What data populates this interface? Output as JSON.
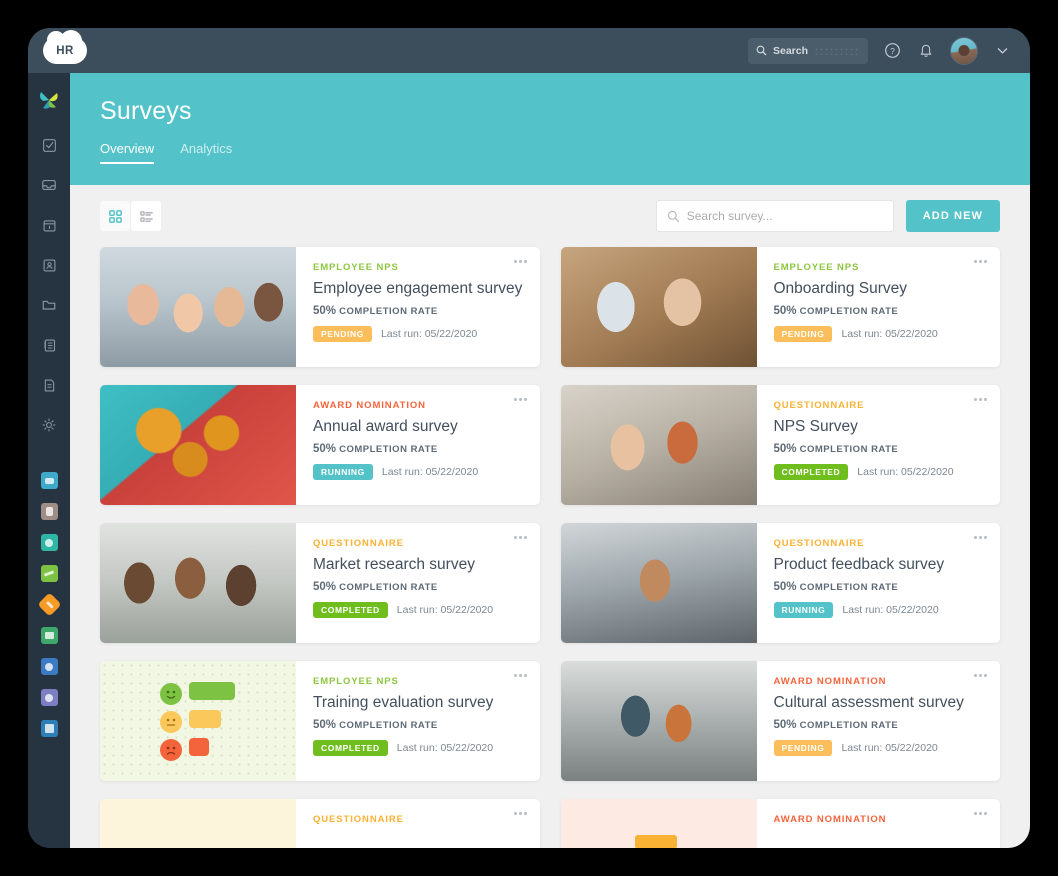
{
  "topbar": {
    "logo_text": "HR",
    "search_label": "Search",
    "help_icon": "help-circle-icon",
    "bell_icon": "bell-icon",
    "avatar_icon": "user-avatar",
    "chevron_icon": "chevron-down-icon"
  },
  "sidebar": {
    "logo_icon": "app-logo-icon",
    "nav_icons": [
      "checkbox-task-icon",
      "inbox-icon",
      "calendar-icon",
      "contact-card-icon",
      "folder-icon",
      "list-document-icon",
      "note-document-icon",
      "gear-settings-icon"
    ],
    "app_icons": [
      {
        "name": "analytics-app-icon",
        "color": "#3FA9C9"
      },
      {
        "name": "briefcase-app-icon",
        "color": "#A08D86"
      },
      {
        "name": "target-app-icon",
        "color": "#2FB7A6"
      },
      {
        "name": "chart-growth-app-icon",
        "color": "#7DC242"
      },
      {
        "name": "plus-diamond-app-icon",
        "color": "#F59B26"
      },
      {
        "name": "monitor-app-icon",
        "color": "#3FA96B"
      },
      {
        "name": "review-app-icon",
        "color": "#3B7BC4"
      },
      {
        "name": "people-app-icon",
        "color": "#7C7FC4"
      },
      {
        "name": "network-app-icon",
        "color": "#2E7FB8"
      }
    ]
  },
  "hero": {
    "title": "Surveys",
    "tabs": [
      {
        "label": "Overview",
        "active": true
      },
      {
        "label": "Analytics",
        "active": false
      }
    ]
  },
  "toolbar": {
    "grid_view_icon": "grid-view-icon",
    "list_view_icon": "list-view-icon",
    "search_icon": "search-icon",
    "search_placeholder": "Search survey...",
    "search_value": "",
    "add_button_label": "ADD NEW"
  },
  "colors": {
    "teal": "#53C3C9",
    "nps_green": "#8DC63F",
    "award_orange": "#F4643C",
    "questionnaire_yellow": "#F9B233",
    "badge_pending": "#FBBE5B",
    "badge_running": "#53C3C9",
    "badge_completed": "#6FBE1E",
    "page_bg": "#F0F0F0",
    "sidebar_bg": "#263340",
    "topbar_bg": "#3C4D5C"
  },
  "cards": [
    {
      "category": "EMPLOYEE NPS",
      "category_type": "nps",
      "title": "Employee engagement survey",
      "rate_value": "50%",
      "rate_label": "COMPLETION RATE",
      "status": "PENDING",
      "status_type": "pending",
      "last_run": "Last run: 05/22/2020",
      "thumb": "photo-group-of-colleagues"
    },
    {
      "category": "EMPLOYEE NPS",
      "category_type": "nps",
      "title": "Onboarding Survey",
      "rate_value": "50%",
      "rate_label": "COMPLETION RATE",
      "status": "PENDING",
      "status_type": "pending",
      "last_run": "Last run: 05/22/2020",
      "thumb": "photo-two-people-at-laptop"
    },
    {
      "category": "AWARD NOMINATION",
      "category_type": "award",
      "title": "Annual award survey",
      "rate_value": "50%",
      "rate_label": "COMPLETION RATE",
      "status": "RUNNING",
      "status_type": "running",
      "last_run": "Last run: 05/22/2020",
      "thumb": "photo-medals"
    },
    {
      "category": "QUESTIONNAIRE",
      "category_type": "quest",
      "title": "NPS Survey",
      "rate_value": "50%",
      "rate_label": "COMPLETION RATE",
      "status": "COMPLETED",
      "status_type": "completed",
      "last_run": "Last run: 05/22/2020",
      "thumb": "photo-two-women-with-tablet"
    },
    {
      "category": "QUESTIONNAIRE",
      "category_type": "quest",
      "title": "Market research survey",
      "rate_value": "50%",
      "rate_label": "COMPLETION RATE",
      "status": "COMPLETED",
      "status_type": "completed",
      "last_run": "Last run: 05/22/2020",
      "thumb": "photo-group-with-tablet"
    },
    {
      "category": "QUESTIONNAIRE",
      "category_type": "quest",
      "title": "Product feedback survey",
      "rate_value": "50%",
      "rate_label": "COMPLETION RATE",
      "status": "RUNNING",
      "status_type": "running",
      "last_run": "Last run: 05/22/2020",
      "thumb": "photo-woman-with-laptop-warehouse"
    },
    {
      "category": "EMPLOYEE NPS",
      "category_type": "nps",
      "title": "Training evaluation survey",
      "rate_value": "50%",
      "rate_label": "COMPLETION RATE",
      "status": "COMPLETED",
      "status_type": "completed",
      "last_run": "Last run: 05/22/2020",
      "thumb": "illustration-smiley-rating"
    },
    {
      "category": "AWARD NOMINATION",
      "category_type": "award",
      "title": "Cultural assessment survey",
      "rate_value": "50%",
      "rate_label": "COMPLETION RATE",
      "status": "PENDING",
      "status_type": "pending",
      "last_run": "Last run: 05/22/2020",
      "thumb": "photo-two-women-in-store"
    }
  ],
  "cards_partial": [
    {
      "category": "QUESTIONNAIRE",
      "category_type": "quest",
      "thumb": "illustration-cream"
    },
    {
      "category": "AWARD NOMINATION",
      "category_type": "award",
      "thumb": "illustration-peach"
    }
  ]
}
